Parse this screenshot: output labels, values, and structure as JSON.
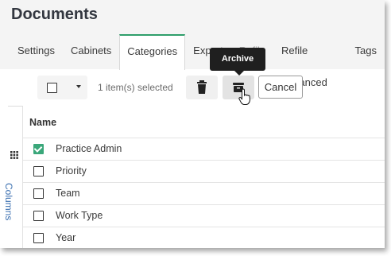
{
  "page": {
    "title": "Documents"
  },
  "tabs": [
    {
      "label": "Settings"
    },
    {
      "label": "Cabinets"
    },
    {
      "label": "Categories"
    },
    {
      "label": "Export"
    },
    {
      "label": "Refile"
    },
    {
      "label": "Refile Advanced"
    },
    {
      "label": "Tags"
    }
  ],
  "active_tab": "Categories",
  "toolbar": {
    "selection_text": "1 item(s) selected",
    "cancel_label": "Cancel",
    "tooltip": "Archive"
  },
  "side_panel": {
    "label": "Columns"
  },
  "table": {
    "column_header": "Name",
    "rows": [
      {
        "label": "Practice Admin",
        "checked": true
      },
      {
        "label": "Priority",
        "checked": false
      },
      {
        "label": "Team",
        "checked": false
      },
      {
        "label": "Work Type",
        "checked": false
      },
      {
        "label": "Year",
        "checked": false
      }
    ]
  },
  "colors": {
    "accent": "#3aa77a",
    "tab_active_border": "#2e9e6a",
    "tooltip_bg": "#1f1f1f"
  }
}
